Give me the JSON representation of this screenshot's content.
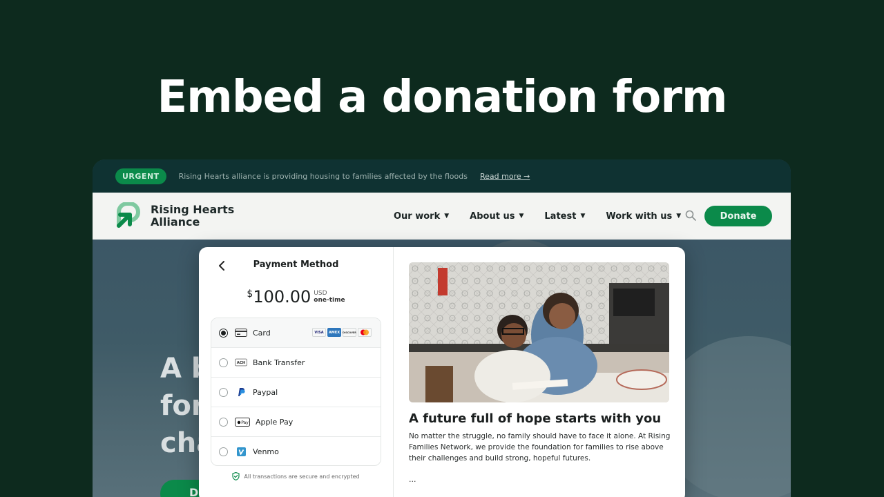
{
  "headline": "Embed a donation form",
  "banner": {
    "badge": "URGENT",
    "message": "Rising Hearts alliance is providing housing to families affected by the floods",
    "link": "Read more →"
  },
  "nav": {
    "logo_line1": "Rising Hearts",
    "logo_line2": "Alliance",
    "items": [
      {
        "label": "Our work"
      },
      {
        "label": "About us"
      },
      {
        "label": "Latest"
      },
      {
        "label": "Work with us"
      }
    ],
    "donate": "Donate"
  },
  "hero": {
    "text": "A b\nfor\ncha",
    "button_label": "D"
  },
  "payment": {
    "title": "Payment Method",
    "currency_symbol": "$",
    "amount": "100.00",
    "currency": "USD",
    "frequency": "one-time",
    "methods": [
      {
        "label": "Card",
        "icon": "card-icon",
        "selected": true
      },
      {
        "label": "Bank Transfer",
        "icon": "ach-icon",
        "selected": false
      },
      {
        "label": "Paypal",
        "icon": "paypal-icon",
        "selected": false
      },
      {
        "label": "Apple Pay",
        "icon": "apple-pay-icon",
        "selected": false
      },
      {
        "label": "Venmo",
        "icon": "venmo-icon",
        "selected": false
      }
    ],
    "card_brands": [
      "VISA",
      "AMEX",
      "DISCOVER",
      "MC"
    ],
    "secure_note": "All transactions are secure and encrypted"
  },
  "story": {
    "title": "A future full of hope starts with you",
    "body": "No matter the struggle, no family should have to face it alone. At Rising Families Network, we provide the foundation for families to rise above their challenges and build strong, hopeful futures.",
    "more": "..."
  },
  "colors": {
    "background": "#0d2a1e",
    "brand_green": "#0b8a4a",
    "banner": "#0f3232"
  }
}
